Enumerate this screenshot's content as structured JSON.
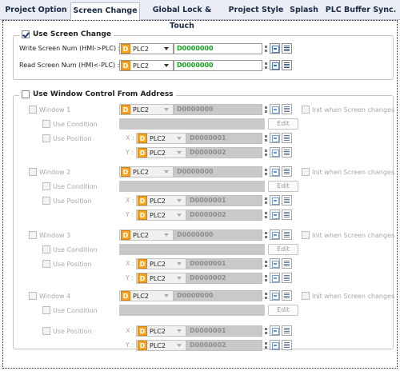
{
  "tabs": [
    {
      "label": "Project Option"
    },
    {
      "label": "Screen Change"
    },
    {
      "label": "Global Lock & Touch"
    },
    {
      "label": "Project Style"
    },
    {
      "label": "Splash"
    },
    {
      "label": "PLC Buffer Sync."
    }
  ],
  "active_tab": "Screen Change",
  "screen_change": {
    "title": "Use Screen Change",
    "checked": true,
    "write_label": "Write Screen Num (HMI->PLC) :",
    "read_label": "Read Screen Num (HMI<-PLC) :",
    "write_device": "PLC2",
    "write_address": "D0000000",
    "read_device": "PLC2",
    "read_address": "D0000000",
    "device_icon": "D"
  },
  "window_control": {
    "title": "Use Window Control From Address",
    "checked": false,
    "use_condition_label": "Use Condition",
    "use_position_label": "Use Position",
    "edit_label": "Edit",
    "init_label": "Init when Screen changes",
    "x_label": "X :",
    "y_label": "Y :",
    "windows": [
      {
        "name": "Window 1",
        "device": "PLC2",
        "address": "D0000000",
        "x_device": "PLC2",
        "x_address": "D0000001",
        "y_device": "PLC2",
        "y_address": "D0000002"
      },
      {
        "name": "Window 2",
        "device": "PLC2",
        "address": "D0000000",
        "x_device": "PLC2",
        "x_address": "D0000001",
        "y_device": "PLC2",
        "y_address": "D0000002"
      },
      {
        "name": "Window 3",
        "device": "PLC2",
        "address": "D0000000",
        "x_device": "PLC2",
        "x_address": "D0000001",
        "y_device": "PLC2",
        "y_address": "D0000002"
      },
      {
        "name": "Window 4",
        "device": "PLC2",
        "address": "D0000000",
        "x_device": "PLC2",
        "x_address": "D0000001",
        "y_device": "PLC2",
        "y_address": "D0000002"
      }
    ]
  },
  "icons": {
    "device_dropdown": "chevron-down-icon",
    "address_keypad": "keypad-icon",
    "address_list": "address-list-icon"
  },
  "colors": {
    "address_text": "#13a01b",
    "device_badge": "#f6a623",
    "disabled_field": "#c9c9c9"
  }
}
